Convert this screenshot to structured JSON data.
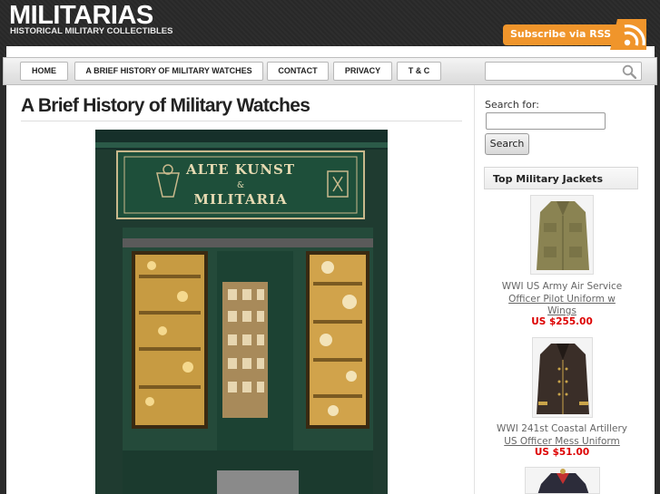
{
  "header": {
    "logo_title": "MILITARIAS",
    "logo_tagline": "HISTORICAL MILITARY COLLECTIBLES",
    "rss_label": "Subscribe via RSS"
  },
  "nav": {
    "items": [
      "HOME",
      "A BRIEF HISTORY OF MILITARY WATCHES",
      "CONTACT",
      "PRIVACY",
      "T & C"
    ]
  },
  "post": {
    "title": "A Brief History of Military Watches",
    "photo_sign_line1": "ALTE KUNST",
    "photo_sign_amp": "&",
    "photo_sign_line2": "MILITARIA"
  },
  "sidebar": {
    "search_label": "Search for:",
    "search_value": "",
    "search_button": "Search",
    "widget_title": "Top Military Jackets",
    "products": [
      {
        "line1": "WWI US Army Air Service",
        "line2": "Officer Pilot Uniform w",
        "line3": "Wings",
        "price": "US $255.00"
      },
      {
        "line1": "WWI 241st Coastal Artillery",
        "line2": "US Officer Mess Uniform",
        "line3": "",
        "price": "US $51.00"
      }
    ]
  },
  "colors": {
    "rss_orange": "#f0952b",
    "price_red": "#dd0000",
    "shopfront_green": "#1e4f3a"
  },
  "icons": [
    "rss-icon",
    "search-icon"
  ]
}
